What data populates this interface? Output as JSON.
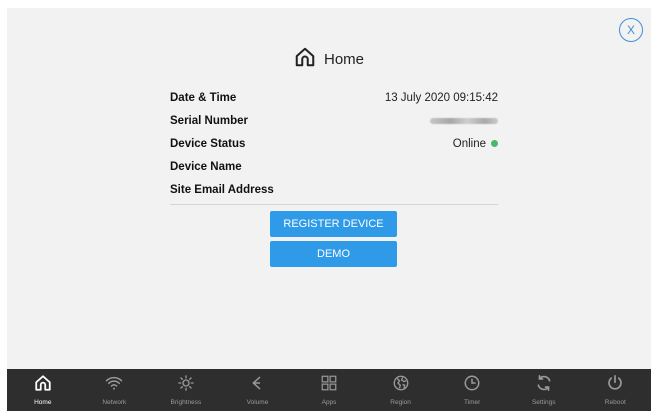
{
  "screen": {
    "close_label": "X",
    "title": "Home",
    "rows": [
      {
        "label": "Date & Time",
        "value": "13 July 2020 09:15:42"
      },
      {
        "label": "Serial Number",
        "value": ""
      },
      {
        "label": "Device Status",
        "value": "Online"
      },
      {
        "label": "Device Name",
        "value": ""
      },
      {
        "label": "Site Email Address",
        "value": ""
      }
    ],
    "status_color": "#49b86a",
    "accent_color": "#2e9ae8",
    "buttons": {
      "register": "REGISTER DEVICE",
      "demo": "DEMO"
    }
  },
  "navbar": {
    "active": "Home",
    "items": [
      {
        "label": "Home",
        "icon": "home-icon"
      },
      {
        "label": "Network",
        "icon": "wifi-icon"
      },
      {
        "label": "Brightness",
        "icon": "brightness-icon"
      },
      {
        "label": "Volume",
        "icon": "volume-icon"
      },
      {
        "label": "Apps",
        "icon": "apps-icon"
      },
      {
        "label": "Region",
        "icon": "globe-icon"
      },
      {
        "label": "Timer",
        "icon": "clock-icon"
      },
      {
        "label": "Settings",
        "icon": "settings-icon"
      },
      {
        "label": "Reboot",
        "icon": "power-icon"
      }
    ]
  }
}
